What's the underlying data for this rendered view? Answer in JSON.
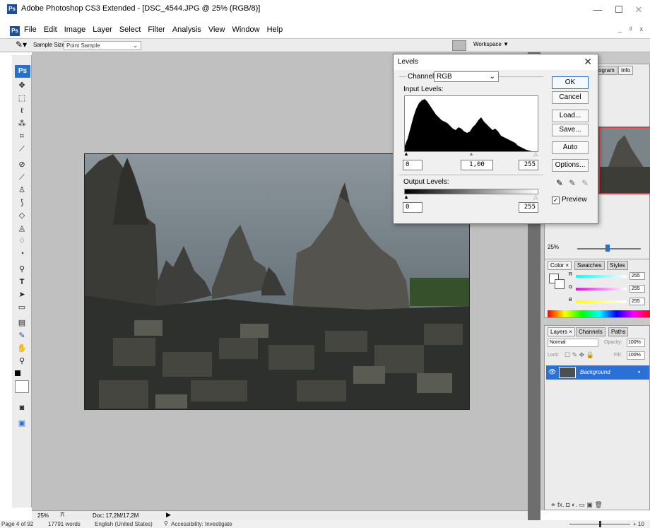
{
  "window": {
    "title": "Adobe Photoshop CS3 Extended - [DSC_4544.JPG @ 25% (RGB/8)]",
    "app_icon": "Ps",
    "minimize": "—",
    "maximize": "☐",
    "close": "✕"
  },
  "menu": [
    "File",
    "Edit",
    "Image",
    "Layer",
    "Select",
    "Filter",
    "Analysis",
    "View",
    "Window",
    "Help"
  ],
  "doc_controls": "_ ₫ x",
  "options_bar": {
    "sample_size_label": "Sample Size:",
    "sample_size_value": "Point Sample",
    "workspace_label": "Workspace ▼"
  },
  "toolbox": {
    "badge": "Ps"
  },
  "levels": {
    "title": "Levels",
    "channel_label": "Channel:",
    "channel_value": "RGB",
    "input_levels_label": "Input Levels:",
    "input_black": "0",
    "input_gamma": "1,00",
    "input_white": "255",
    "output_levels_label": "Output Levels:",
    "output_black": "0",
    "output_white": "255",
    "buttons": {
      "ok": "OK",
      "cancel": "Cancel",
      "load": "Load...",
      "save": "Save...",
      "auto": "Auto",
      "options": "Options..."
    },
    "preview_label": "Preview",
    "preview_checked": true
  },
  "navigator": {
    "tabs": [
      "ogram",
      "Info"
    ],
    "zoom": "25%"
  },
  "color_panel": {
    "tabs": [
      "Color ×",
      "Swatches",
      "Styles"
    ],
    "r_label": "R",
    "r_value": "255",
    "g_label": "G",
    "g_value": "255",
    "b_label": "B",
    "b_value": "255"
  },
  "layers_panel": {
    "tabs": [
      "Layers ×",
      "Channels",
      "Paths"
    ],
    "blend_mode": "Normal",
    "opacity_label": "Opacity:",
    "opacity_value": "100%",
    "lock_label": "Lock:",
    "fill_label": "Fill:",
    "fill_value": "100%",
    "layer_name": "Background",
    "footer_icons": "⚭ fx. ◘ ◐. ▭ ▣ 🗑"
  },
  "ps_status": {
    "zoom": "25%",
    "doc": "Doc: 17,2M/17,2M"
  },
  "word_status": {
    "page": "Page 4 of 92",
    "words": "17791 words",
    "language": "English (United States)",
    "accessibility": "Accessibility: Investigate",
    "zoom_pct": "+ 10"
  }
}
